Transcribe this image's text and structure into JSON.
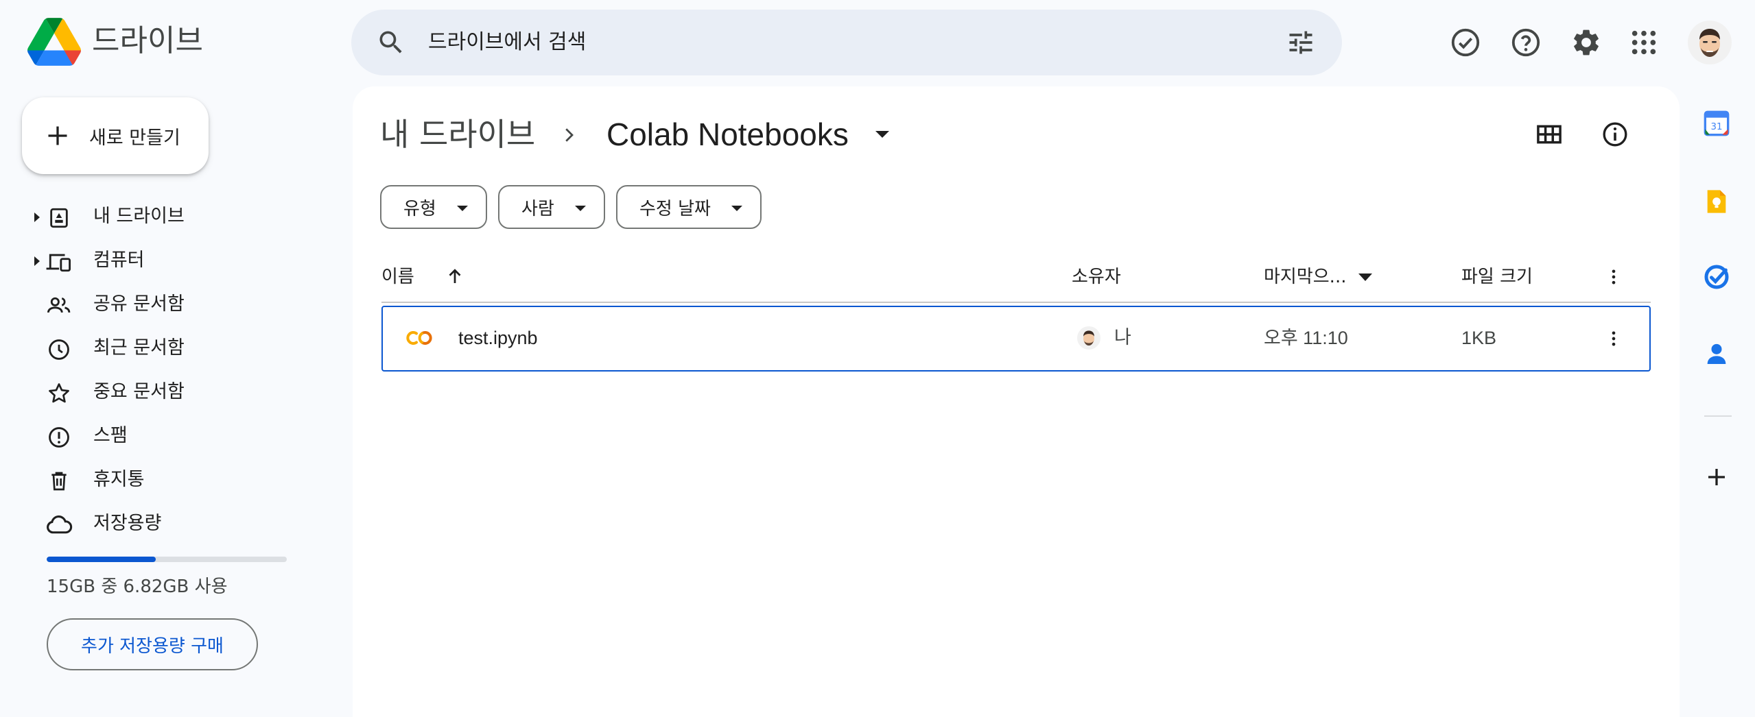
{
  "app": {
    "brand": "드라이브"
  },
  "search": {
    "placeholder": "드라이브에서 검색"
  },
  "sidebar": {
    "new_label": "새로 만들기",
    "items": [
      {
        "label": "내 드라이브",
        "icon": "my-drive-icon",
        "expandable": true
      },
      {
        "label": "컴퓨터",
        "icon": "computer-icon",
        "expandable": true
      },
      {
        "label": "공유 문서함",
        "icon": "shared-icon",
        "expandable": false
      },
      {
        "label": "최근 문서함",
        "icon": "clock-icon",
        "expandable": false
      },
      {
        "label": "중요 문서함",
        "icon": "star-icon",
        "expandable": false
      },
      {
        "label": "스팸",
        "icon": "spam-icon",
        "expandable": false
      },
      {
        "label": "휴지통",
        "icon": "trash-icon",
        "expandable": false
      },
      {
        "label": "저장용량",
        "icon": "cloud-icon",
        "expandable": false
      }
    ],
    "storage": {
      "used_fraction": 0.455,
      "text": "15GB 중 6.82GB 사용"
    },
    "buy_label": "추가 저장용량 구매"
  },
  "breadcrumb": {
    "root": "내 드라이브",
    "current": "Colab Notebooks"
  },
  "filters": [
    "유형",
    "사람",
    "수정 날짜"
  ],
  "table": {
    "headers": {
      "name": "이름",
      "owner": "소유자",
      "modified": "마지막으...",
      "size": "파일 크기"
    },
    "rows": [
      {
        "name": "test.ipynb",
        "owner": "나",
        "modified": "오후 11:10",
        "size": "1KB",
        "icon": "colab-icon"
      }
    ]
  },
  "colors": {
    "accent": "#0b57d0",
    "background": "#f8fafd",
    "search_bg": "#e9eef6"
  }
}
